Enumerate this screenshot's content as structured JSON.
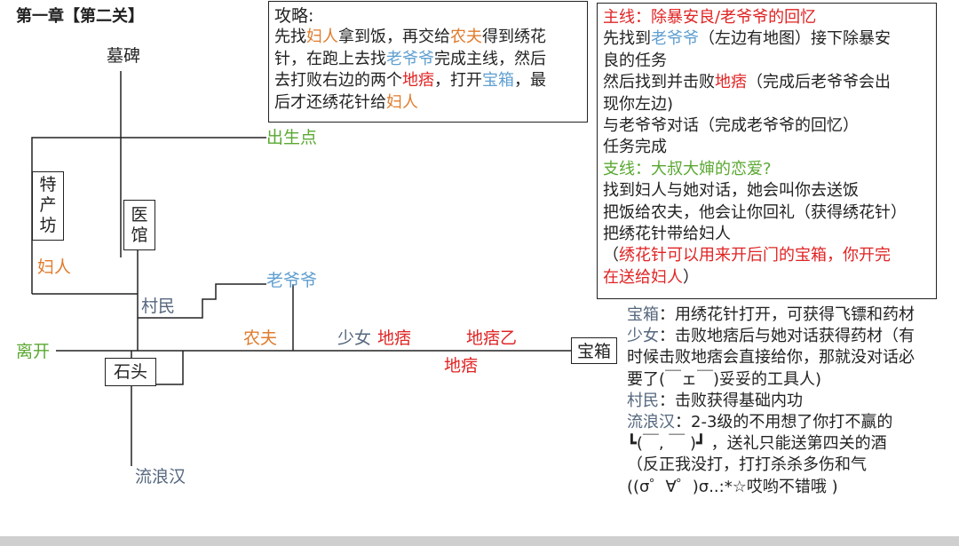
{
  "title": "第一章【第二关】",
  "places": {
    "tomb": "墓碑",
    "spawn": "出生点",
    "specialty_shop": [
      "特",
      "产",
      "坊"
    ],
    "clinic": [
      "医",
      "馆"
    ],
    "woman": "妇人",
    "grandpa": "老爷爷",
    "villager": "村民",
    "leave": "离开",
    "farmer": "农夫",
    "girl": "少女",
    "ruffian_1": "地痞",
    "ruffian_b": "地痞乙",
    "ruffian_2": "地痞",
    "chest": "宝箱",
    "stone": "石头",
    "vagrant": "流浪汉"
  },
  "strategy": {
    "heading": "攻略:",
    "lines": [
      [
        {
          "t": "先找",
          "c": "black"
        },
        {
          "t": "妇人",
          "c": "orange"
        },
        {
          "t": "拿到饭，再交给",
          "c": "black"
        },
        {
          "t": "农夫",
          "c": "orange"
        },
        {
          "t": "得到绣花",
          "c": "black"
        }
      ],
      [
        {
          "t": "针，在跑上去找",
          "c": "black"
        },
        {
          "t": "老爷爷",
          "c": "blue"
        },
        {
          "t": "完成主线，然后",
          "c": "black"
        }
      ],
      [
        {
          "t": "去打败右边的两个",
          "c": "black"
        },
        {
          "t": "地痞",
          "c": "red"
        },
        {
          "t": "，打开",
          "c": "black"
        },
        {
          "t": "宝箱",
          "c": "blue"
        },
        {
          "t": "，最",
          "c": "black"
        }
      ],
      [
        {
          "t": "后才还绣花针给",
          "c": "black"
        },
        {
          "t": "妇人",
          "c": "orange"
        }
      ]
    ]
  },
  "quests": {
    "lines": [
      [
        {
          "t": "主线：除暴安良/老爷爷的回忆",
          "c": "red"
        }
      ],
      [
        {
          "t": "先找到",
          "c": "black"
        },
        {
          "t": "老爷爷",
          "c": "blue"
        },
        {
          "t": "（左边有地图）接下除暴安",
          "c": "black"
        }
      ],
      [
        {
          "t": "良的任务",
          "c": "black"
        }
      ],
      [
        {
          "t": "然后找到并击败",
          "c": "black"
        },
        {
          "t": "地痞",
          "c": "red"
        },
        {
          "t": "（完成后老爷爷会出",
          "c": "black"
        }
      ],
      [
        {
          "t": "现你左边)",
          "c": "black"
        }
      ],
      [
        {
          "t": "与老爷爷对话（完成老爷爷的回忆）",
          "c": "black"
        }
      ],
      [
        {
          "t": "任务完成",
          "c": "black"
        }
      ],
      [
        {
          "t": "支线：大叔大婶的恋爱?",
          "c": "green"
        }
      ],
      [
        {
          "t": "找到妇人与她对话，她会叫你去送饭",
          "c": "black"
        }
      ],
      [
        {
          "t": "把饭给农夫，他会让你回礼（获得绣花针）",
          "c": "black"
        }
      ],
      [
        {
          "t": "把绣花针带给妇人",
          "c": "black"
        }
      ],
      [
        {
          "t": "（",
          "c": "black"
        },
        {
          "t": "绣花针可以用来开后门的宝箱，你开完",
          "c": "red"
        }
      ],
      [
        {
          "t": "在送给妇人",
          "c": "red"
        },
        {
          "t": "）",
          "c": "black"
        }
      ]
    ]
  },
  "notes": {
    "lines": [
      [
        {
          "t": "宝箱",
          "c": "slate"
        },
        {
          "t": "：用绣花针打开，可获得飞镖和药材",
          "c": "black"
        }
      ],
      [
        {
          "t": "少女",
          "c": "slate"
        },
        {
          "t": "：击败地痞后与她对话获得药材（有",
          "c": "black"
        }
      ],
      [
        {
          "t": "时候击败地痞会直接给你，那就没对话必",
          "c": "black"
        }
      ],
      [
        {
          "t": "要了(￣ェ￣)妥妥的工具人)",
          "c": "black"
        }
      ],
      [
        {
          "t": "村民",
          "c": "slate"
        },
        {
          "t": "：击败获得基础内功",
          "c": "black"
        }
      ],
      [
        {
          "t": "流浪汉",
          "c": "slate"
        },
        {
          "t": "：2-3级的不用想了你打不赢的",
          "c": "black"
        }
      ],
      [
        {
          "t": "  ┗(￣, ￣ )┛ ，送礼只能送第四关的酒",
          "c": "black"
        }
      ],
      [
        {
          "t": " （反正我没打，打打杀杀多伤和气",
          "c": "black"
        }
      ],
      [
        {
          "t": "((σ゜∀゜)σ..:*☆哎哟不错哦 )",
          "c": "black"
        }
      ]
    ]
  },
  "colors": {
    "black": "#222222",
    "orange": "#e07b2c",
    "blue": "#5f9fd1",
    "red": "#e02424",
    "green": "#5aa832",
    "slate": "#55677d"
  }
}
